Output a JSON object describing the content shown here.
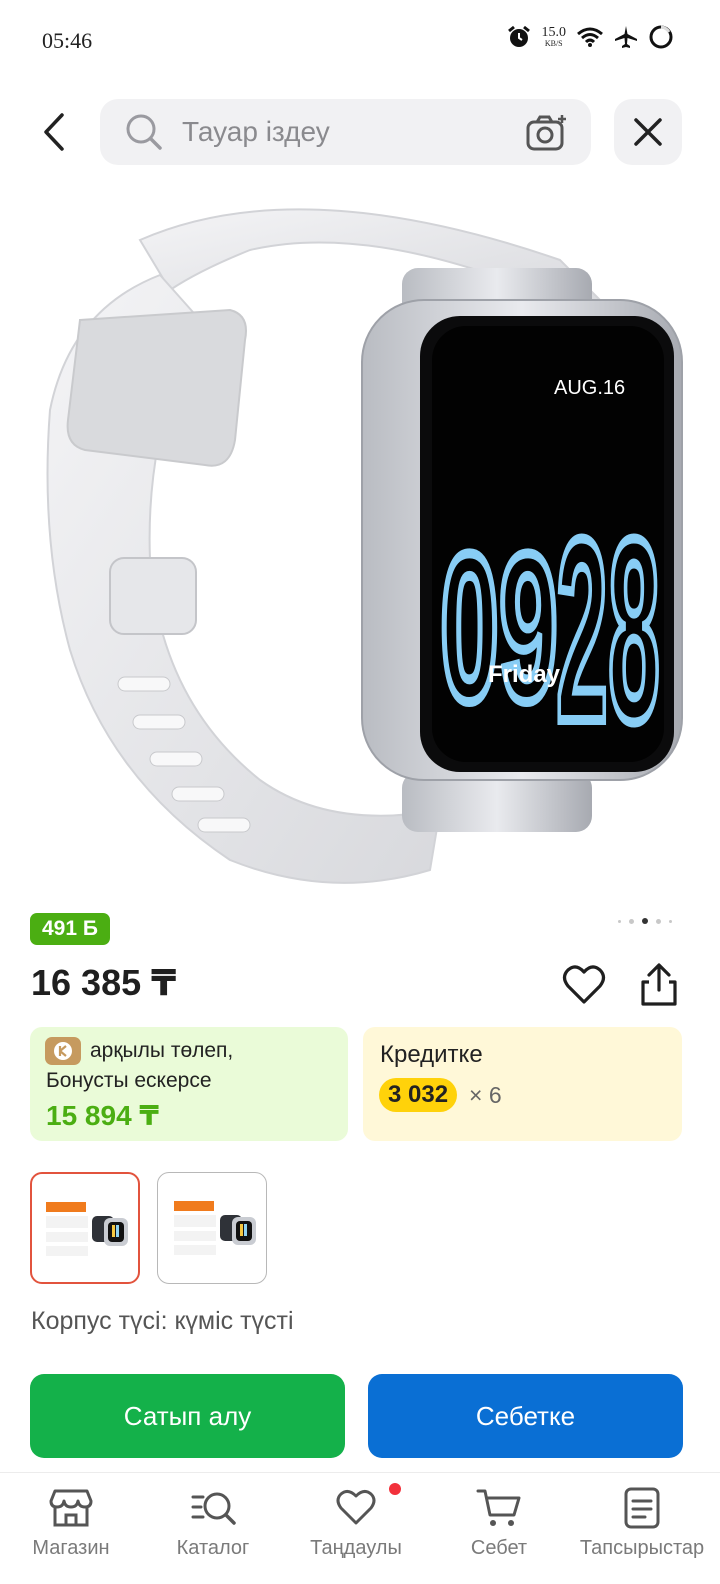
{
  "status_bar": {
    "time": "05:46",
    "net_speed_value": "15.0",
    "net_speed_unit": "KB/S",
    "icons": [
      "alarm-icon",
      "wifi-icon",
      "airplane-icon",
      "battery-ring-icon"
    ]
  },
  "search": {
    "placeholder": "Тауар іздеу"
  },
  "product_image": {
    "watch_date": "AUG.16",
    "watch_time_hours": "09",
    "watch_time_minutes": "28",
    "watch_day": "Friday"
  },
  "gallery": {
    "dot_count": 5,
    "active_index": 2
  },
  "bonus_badge": "491 Б",
  "price": "16 385 ₸",
  "pay_with_bonus": {
    "line1": "арқылы төлеп,",
    "line2": "Бонусты ескерсе",
    "amount": "15 894 ₸"
  },
  "credit": {
    "title": "Кредитке",
    "monthly": "3 032",
    "months": "× 6"
  },
  "variant_label": "Корпус түсі: күміс түсті",
  "actions": {
    "buy": "Сатып алу",
    "add_to_cart": "Себетке"
  },
  "bottom_nav": [
    {
      "label": "Магазин",
      "icon": "shop-icon"
    },
    {
      "label": "Каталог",
      "icon": "catalog-search-icon"
    },
    {
      "label": "Таңдаулы",
      "icon": "heart-icon"
    },
    {
      "label": "Себет",
      "icon": "cart-icon"
    },
    {
      "label": "Тапсырыстар",
      "icon": "orders-icon"
    }
  ],
  "colors": {
    "accent_green": "#4bae12",
    "buy_green": "#14b14a",
    "cart_blue": "#0a6fd4",
    "credit_yellow": "#ffd20a",
    "selected_border": "#e2533d"
  }
}
